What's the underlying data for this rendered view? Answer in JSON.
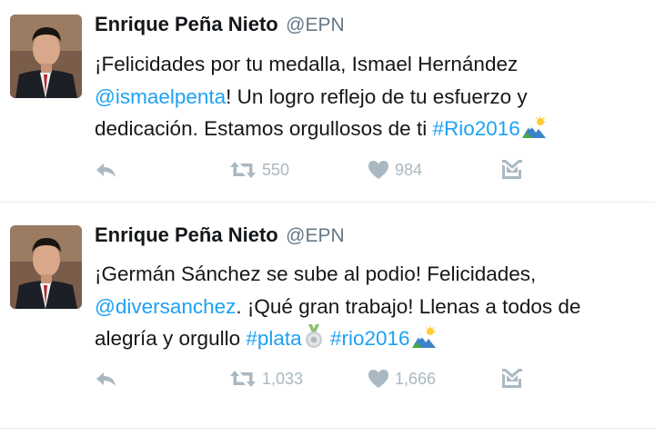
{
  "tweets": [
    {
      "author_name": "Enrique Peña Nieto",
      "author_handle": "@EPN",
      "text_lines": [
        [
          {
            "text": "¡Felicidades por tu medalla, Ismael Hernández",
            "link": false
          }
        ],
        [
          {
            "text": "@ismaelpenta",
            "link": true
          },
          {
            "text": "! Un logro  reflejo de tu esfuerzo y",
            "link": false
          }
        ],
        [
          {
            "text": "dedicación. Estamos orgullosos de ti ",
            "link": false
          },
          {
            "text": "#Rio2016",
            "link": true
          }
        ]
      ],
      "retweets": "550",
      "likes": "984"
    },
    {
      "author_name": "Enrique Peña Nieto",
      "author_handle": "@EPN",
      "text_lines": [
        [
          {
            "text": "¡Germán Sánchez se sube al podio! Felicidades,",
            "link": false
          }
        ],
        [
          {
            "text": "@diversanchez",
            "link": true
          },
          {
            "text": ". ¡Qué gran trabajo! Llenas a todos de",
            "link": false
          }
        ],
        [
          {
            "text": "alegría y orgullo ",
            "link": false
          },
          {
            "text": "#plata",
            "link": true
          },
          {
            "text": " ",
            "link": false
          },
          {
            "text": "#rio2016",
            "link": true
          }
        ]
      ],
      "retweets": "1,033",
      "likes": "1,666"
    }
  ],
  "icons": {
    "reply": "reply-icon",
    "retweet": "retweet-icon",
    "like": "heart-icon",
    "dm": "direct-message-icon",
    "mountain_emoji": "mountain-sun-emoji-icon",
    "medal_emoji": "silver-medal-emoji-icon"
  },
  "colors": {
    "link": "#1da1f2",
    "action": "#aab8c2",
    "handle": "#657786",
    "text": "#14171a"
  }
}
